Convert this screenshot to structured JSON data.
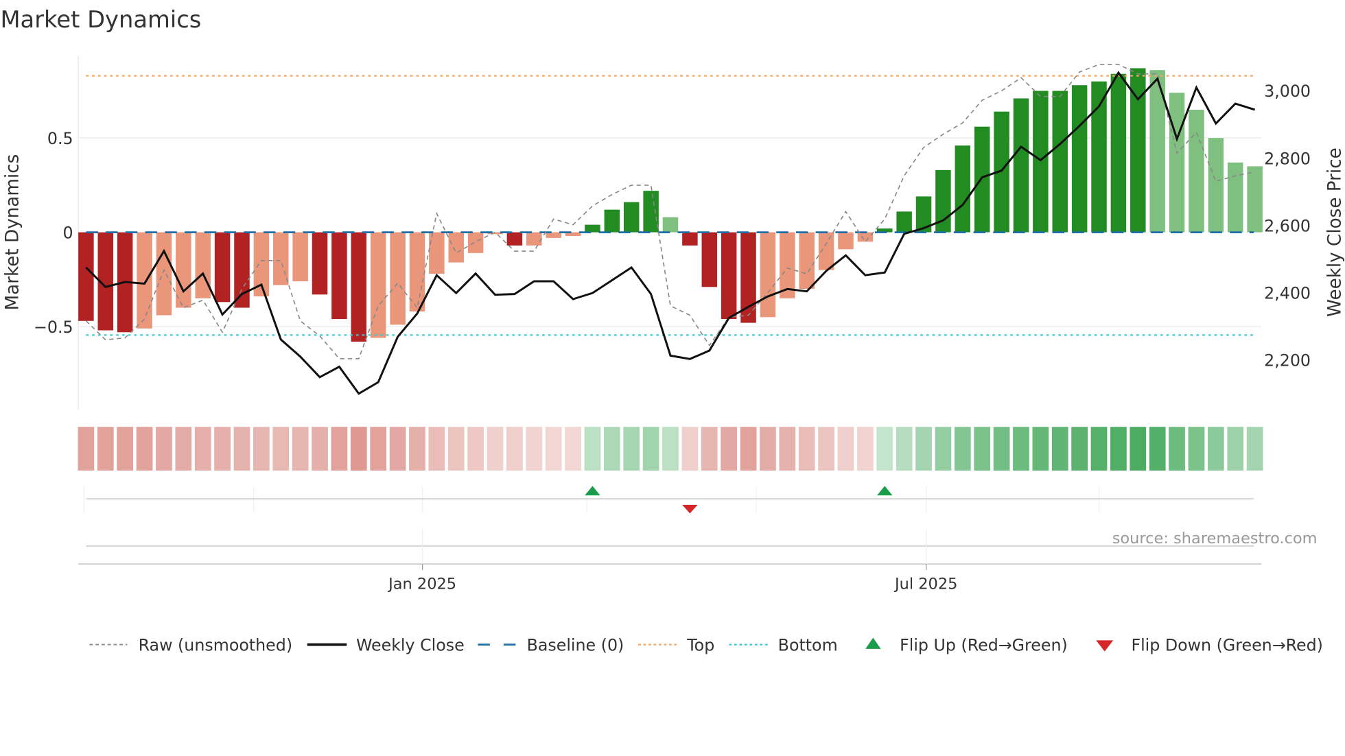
{
  "title": "Market Dynamics",
  "source": "source: sharemaestro.com",
  "colors": {
    "bar_red_dark": "#b22222",
    "bar_red_light": "#e9967a",
    "bar_green_dark": "#228b22",
    "bar_green_light": "#7fbf7f",
    "strip_red": "#c8554b",
    "strip_green": "#2e9e48",
    "raw": "#888888",
    "close": "#111111",
    "baseline": "#1f6fa6",
    "top": "#f0a868",
    "bottom": "#3cc8d8",
    "flip_up": "#1a9c4a",
    "flip_down": "#d62728"
  },
  "chart_data": {
    "type": "bar",
    "title": "Market Dynamics",
    "ylabel": "Market Dynamics",
    "y2label": "Weekly Close Price",
    "ylim": [
      -0.94,
      0.94
    ],
    "y2lim": [
      2090,
      3060
    ],
    "yticks": [
      {
        "v": 0.5,
        "label": "0.5"
      },
      {
        "v": 0,
        "label": "0"
      },
      {
        "v": -0.5,
        "label": "−0.5"
      }
    ],
    "y2ticks": [
      {
        "v": 3000,
        "label": "3,000"
      },
      {
        "v": 2800,
        "label": "2,800"
      },
      {
        "v": 2600,
        "label": "2,600"
      },
      {
        "v": 2400,
        "label": "2,400"
      },
      {
        "v": 2200,
        "label": "2,200"
      }
    ],
    "xticks": [
      {
        "week": 17.27,
        "label": "Jan 2025"
      },
      {
        "week": 43.13,
        "label": "Jul 2025"
      }
    ],
    "minor_xgrid_weeks": [
      -0.1,
      8.6,
      17.27,
      25.7,
      34.4,
      43.13,
      52.0
    ],
    "top_level": 0.83,
    "bottom_level": -0.545,
    "baseline": 0,
    "dynamics": [
      -0.47,
      -0.52,
      -0.53,
      -0.51,
      -0.44,
      -0.4,
      -0.35,
      -0.37,
      -0.4,
      -0.34,
      -0.28,
      -0.26,
      -0.33,
      -0.46,
      -0.58,
      -0.56,
      -0.49,
      -0.42,
      -0.22,
      -0.16,
      -0.11,
      -0.01,
      -0.07,
      -0.07,
      -0.03,
      -0.02,
      0.04,
      0.12,
      0.16,
      0.22,
      0.08,
      -0.07,
      -0.29,
      -0.46,
      -0.48,
      -0.45,
      -0.35,
      -0.3,
      -0.2,
      -0.09,
      -0.05,
      0.02,
      0.11,
      0.19,
      0.33,
      0.46,
      0.56,
      0.64,
      0.71,
      0.75,
      0.75,
      0.78,
      0.8,
      0.84,
      0.87,
      0.86,
      0.74,
      0.65,
      0.5,
      0.37,
      0.35
    ],
    "shade": [
      "D",
      "D",
      "D",
      "L",
      "L",
      "L",
      "L",
      "D",
      "D",
      "L",
      "L",
      "L",
      "D",
      "D",
      "D",
      "L",
      "L",
      "L",
      "L",
      "L",
      "L",
      "L",
      "D",
      "L",
      "L",
      "L",
      "D",
      "D",
      "D",
      "D",
      "L",
      "D",
      "D",
      "D",
      "D",
      "L",
      "L",
      "L",
      "L",
      "L",
      "L",
      "D",
      "D",
      "D",
      "D",
      "D",
      "D",
      "D",
      "D",
      "D",
      "D",
      "D",
      "D",
      "D",
      "D",
      "L",
      "L",
      "L",
      "L",
      "L",
      "L"
    ],
    "raw": [
      -0.47,
      -0.57,
      -0.56,
      -0.46,
      -0.2,
      -0.4,
      -0.36,
      -0.53,
      -0.3,
      -0.15,
      -0.15,
      -0.47,
      -0.55,
      -0.67,
      -0.67,
      -0.39,
      -0.27,
      -0.4,
      0.1,
      -0.11,
      -0.05,
      0.0,
      -0.1,
      -0.1,
      0.07,
      0.04,
      0.14,
      0.2,
      0.25,
      0.25,
      -0.39,
      -0.44,
      -0.6,
      -0.45,
      -0.44,
      -0.32,
      -0.19,
      -0.22,
      -0.06,
      0.11,
      -0.05,
      0.07,
      0.3,
      0.45,
      0.52,
      0.58,
      0.7,
      0.75,
      0.82,
      0.72,
      0.72,
      0.85,
      0.89,
      0.89,
      0.84,
      0.84,
      0.42,
      0.53,
      0.27,
      0.3,
      0.32
    ],
    "weekly_close": [
      2475,
      2417,
      2432,
      2427,
      2524,
      2404,
      2457,
      2335,
      2396,
      2424,
      2261,
      2210,
      2149,
      2180,
      2100,
      2134,
      2269,
      2338,
      2452,
      2399,
      2457,
      2394,
      2396,
      2434,
      2434,
      2381,
      2399,
      2437,
      2475,
      2396,
      2213,
      2203,
      2228,
      2325,
      2358,
      2389,
      2411,
      2404,
      2465,
      2511,
      2452,
      2460,
      2575,
      2592,
      2615,
      2661,
      2743,
      2763,
      2834,
      2794,
      2842,
      2896,
      2954,
      3054,
      2975,
      3036,
      2857,
      3010,
      2903,
      2962,
      2944
    ],
    "strip_intensity": [
      0.55,
      0.55,
      0.55,
      0.55,
      0.5,
      0.48,
      0.45,
      0.45,
      0.42,
      0.4,
      0.38,
      0.4,
      0.45,
      0.55,
      0.62,
      0.55,
      0.5,
      0.45,
      0.35,
      0.3,
      0.25,
      0.2,
      0.22,
      0.18,
      0.15,
      0.15,
      0.25,
      0.35,
      0.38,
      0.42,
      0.25,
      0.22,
      0.4,
      0.5,
      0.55,
      0.48,
      0.42,
      0.35,
      0.3,
      0.22,
      0.18,
      0.2,
      0.3,
      0.4,
      0.5,
      0.6,
      0.65,
      0.7,
      0.75,
      0.8,
      0.82,
      0.85,
      0.88,
      0.92,
      0.95,
      0.9,
      0.75,
      0.65,
      0.55,
      0.45,
      0.4
    ],
    "flips": [
      {
        "week": 26,
        "dir": "up"
      },
      {
        "week": 31,
        "dir": "down"
      },
      {
        "week": 41,
        "dir": "up"
      }
    ],
    "legend": [
      {
        "key": "raw",
        "label": "Raw (unsmoothed)"
      },
      {
        "key": "close",
        "label": "Weekly Close"
      },
      {
        "key": "baseline",
        "label": "Baseline (0)"
      },
      {
        "key": "top",
        "label": "Top"
      },
      {
        "key": "bottom",
        "label": "Bottom"
      },
      {
        "key": "flip_up",
        "label": "Flip Up (Red→Green)"
      },
      {
        "key": "flip_down",
        "label": "Flip Down (Green→Red)"
      }
    ],
    "legend_position": "bottom"
  }
}
